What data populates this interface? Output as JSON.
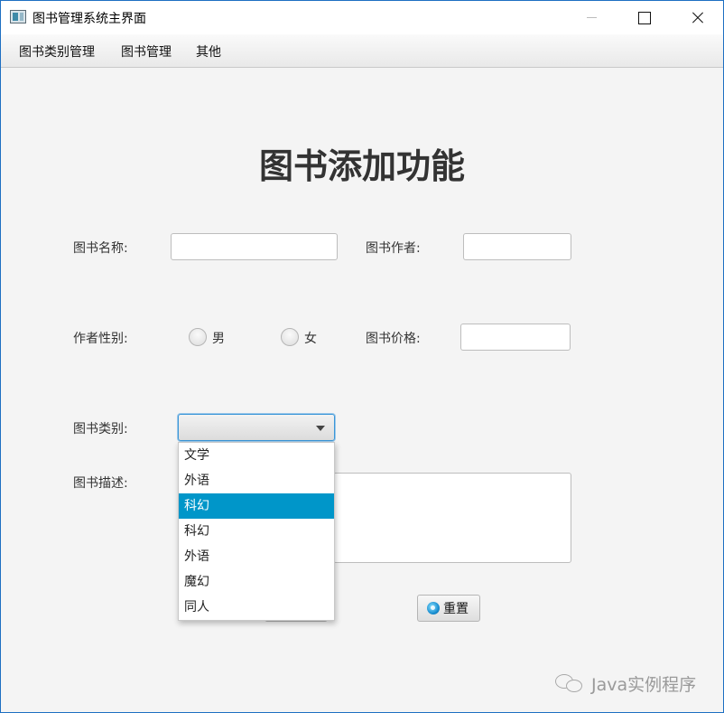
{
  "window": {
    "title": "图书管理系统主界面"
  },
  "menu": {
    "items": [
      "图书类别管理",
      "图书管理",
      "其他"
    ]
  },
  "form": {
    "title": "图书添加功能",
    "book_name_label": "图书名称:",
    "book_name_value": "",
    "author_label": "图书作者:",
    "author_value": "",
    "gender_label": "作者性别:",
    "gender_options": [
      "男",
      "女"
    ],
    "price_label": "图书价格:",
    "price_value": "",
    "category_label": "图书类别:",
    "category_selected": "",
    "category_options": [
      "文学",
      "外语",
      "科幻",
      "科幻",
      "外语",
      "魔幻",
      "同人"
    ],
    "category_highlighted_index": 2,
    "description_label": "图书描述:",
    "description_value": "",
    "reset_button": "重置"
  },
  "watermark": {
    "text": "Java实例程序"
  },
  "colors": {
    "highlight": "#0096c9",
    "window_border": "#1e6fc2",
    "focus_border": "#3a96d8"
  }
}
